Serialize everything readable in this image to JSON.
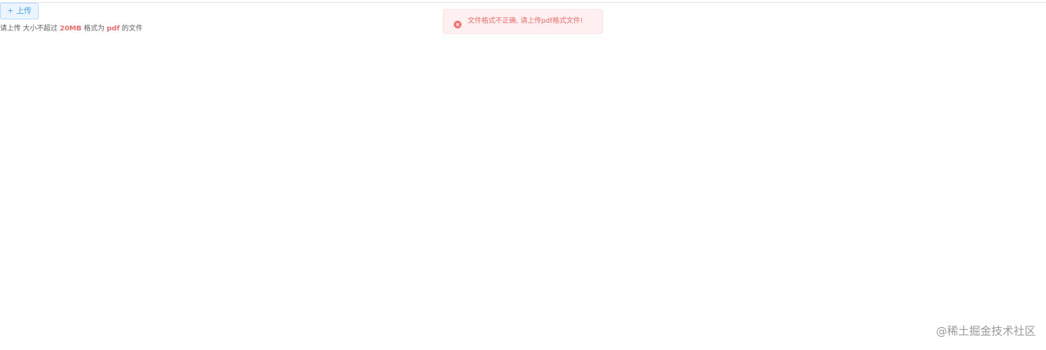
{
  "upload": {
    "button_plus": "+",
    "button_label": "上传",
    "tip_prefix": "请上传 大小不超过",
    "tip_size": "20MB",
    "tip_format_prefix": "格式为",
    "tip_format": "pdf",
    "tip_suffix": "的文件"
  },
  "message": {
    "type": "error",
    "icon": "circle-close-icon",
    "text": "文件格式不正确, 请上传pdf格式文件!"
  },
  "watermark": {
    "text": "@稀土掘金技术社区"
  },
  "colors": {
    "primary": "#409eff",
    "danger": "#f56c6c",
    "danger_bg": "#fef0f0",
    "text": "#606266"
  }
}
